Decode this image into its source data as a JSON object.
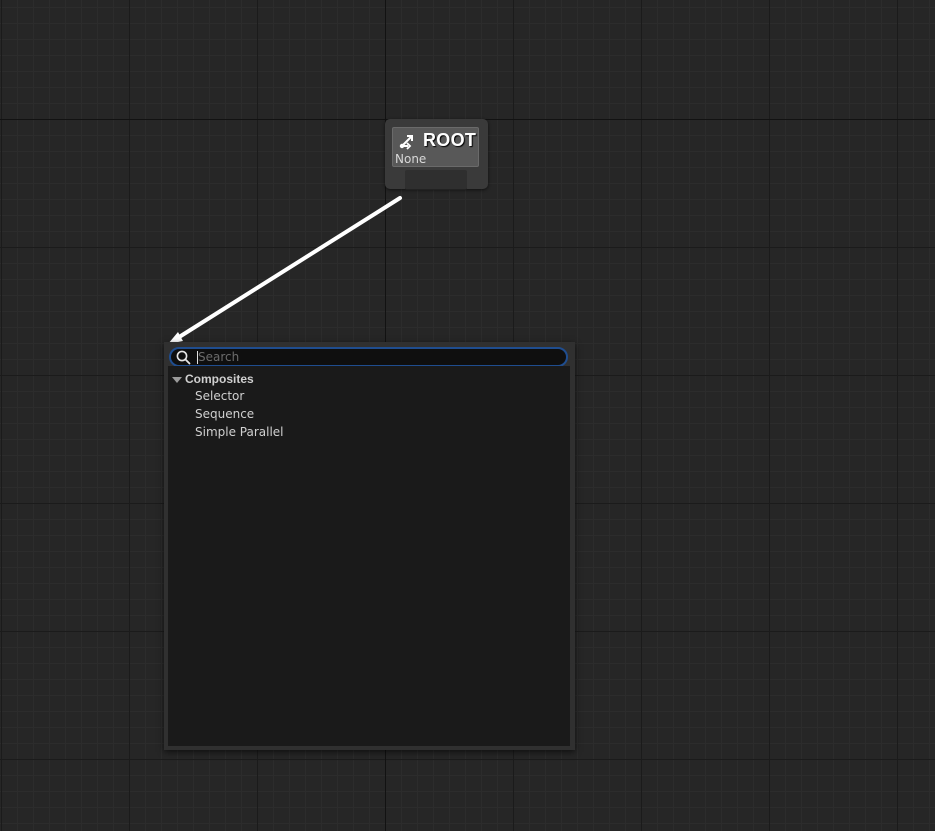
{
  "root_node": {
    "title": "ROOT",
    "subtitle": "None",
    "icon": "branch-icon"
  },
  "context_menu": {
    "search": {
      "placeholder": "Search",
      "value": "",
      "icon": "search-icon"
    },
    "categories": [
      {
        "label": "Composites",
        "expanded": true,
        "items": [
          {
            "label": "Selector"
          },
          {
            "label": "Sequence"
          },
          {
            "label": "Simple Parallel"
          }
        ]
      }
    ]
  },
  "colors": {
    "graph_background": "#262626",
    "search_border": "#1f4d8f",
    "wire": "#ffffff"
  }
}
